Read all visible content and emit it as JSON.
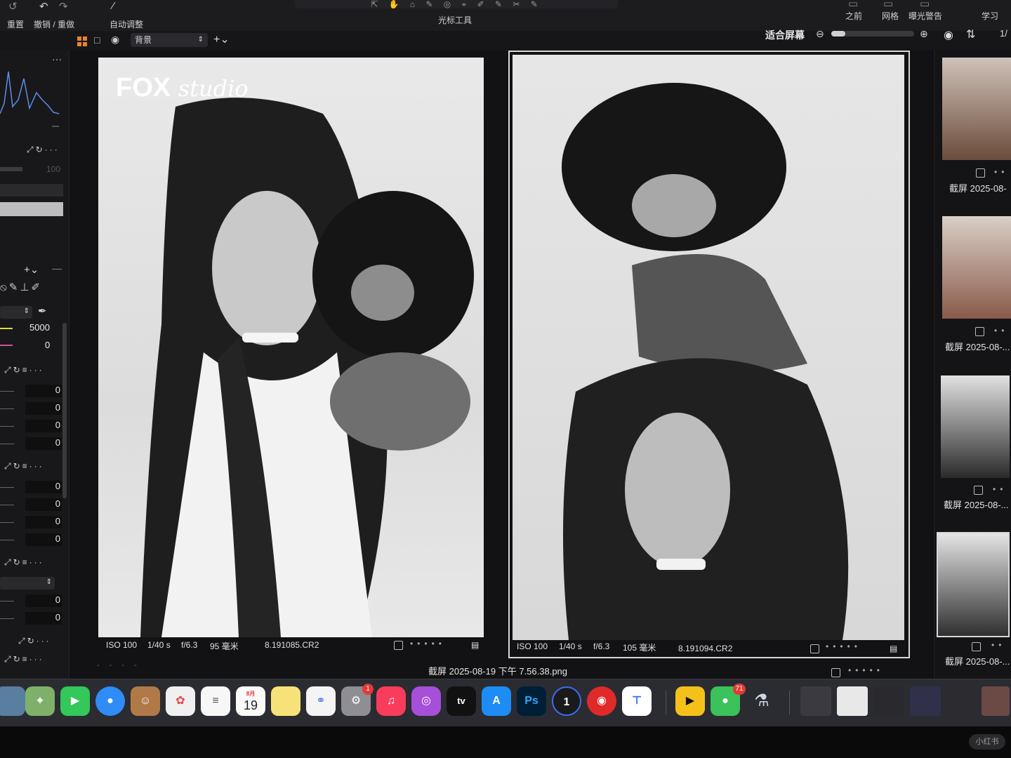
{
  "toolbar": {
    "reset_label": "重置",
    "undo_redo_label": "撤销 / 重做",
    "auto_adjust_label": "自动调整",
    "cursor_tools_label": "光标工具",
    "before_label": "之前",
    "grid_label": "网格",
    "exposure_warning_label": "曝光警告",
    "learn_label": "学习"
  },
  "viewbar": {
    "layer_select": "背景",
    "fit_screen_label": "适合屏幕",
    "page_indicator": "1/"
  },
  "left_panel": {
    "histogram_max": "100",
    "white_balance_kelvin": "5000",
    "tint_value": "0",
    "group1_values": [
      "0",
      "0",
      "0",
      "0"
    ],
    "group2_values": [
      "0",
      "0",
      "0",
      "0"
    ],
    "group3_values": [
      "0",
      "0"
    ]
  },
  "photos": [
    {
      "logo": "FOX",
      "logo_script": "studio",
      "iso": "ISO 100",
      "shutter": "1/40 s",
      "aperture": "f/6.3",
      "focal": "95 毫米",
      "filename": "8.191085.CR2"
    },
    {
      "iso": "ISO 100",
      "shutter": "1/40 s",
      "aperture": "f/6.3",
      "focal": "105 毫米",
      "filename": "8.191094.CR2"
    }
  ],
  "caption": "截屏 2025-08-19 下午 7.56.38.png",
  "filmstrip": [
    {
      "label": "截屏 2025-08-"
    },
    {
      "label": "截屏 2025-08-..."
    },
    {
      "label": "截屏 2025-08-..."
    },
    {
      "label": "截屏 2025-08-..."
    }
  ],
  "dock": {
    "calendar_month": "8月",
    "calendar_day": "19",
    "photoshop": "Ps",
    "settings_badge": "1",
    "wechat_badge": "71",
    "tv_label": "tv"
  },
  "watermark": "小红书",
  "colors": {
    "accent": "#e8832a",
    "dock_bg": "#2b2c31",
    "panel_bg": "#18181a"
  }
}
